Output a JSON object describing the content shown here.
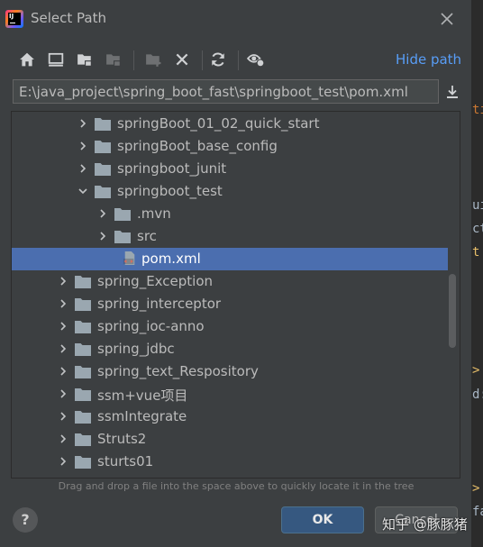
{
  "dialog": {
    "title": "Select Path",
    "logo_text": "IJ",
    "hide_path_label": "Hide path",
    "path_value": "E:\\java_project\\spring_boot_fast\\springboot_test\\pom.xml",
    "hint": "Drag and drop a file into the space above to quickly locate it in the tree",
    "help_label": "?",
    "ok_label": "OK",
    "cancel_label": "Cancel",
    "accent_color": "#4b6eaf"
  },
  "toolbar": {
    "icons": [
      "home-icon",
      "desktop-icon",
      "project-folder-icon",
      "module-folder-icon",
      "new-folder-icon",
      "delete-icon",
      "refresh-icon",
      "show-hidden-icon"
    ]
  },
  "tree": {
    "rows": [
      {
        "label": "springBoot_01_02_quick_start",
        "type": "folder",
        "expanded": false,
        "level": 3
      },
      {
        "label": "springBoot_base_config",
        "type": "folder",
        "expanded": false,
        "level": 3
      },
      {
        "label": "springboot_junit",
        "type": "folder",
        "expanded": false,
        "level": 3
      },
      {
        "label": "springboot_test",
        "type": "folder",
        "expanded": true,
        "level": 3
      },
      {
        "label": ".mvn",
        "type": "folder",
        "expanded": false,
        "level": 4
      },
      {
        "label": "src",
        "type": "folder",
        "expanded": false,
        "level": 4
      },
      {
        "label": "pom.xml",
        "type": "maven-file",
        "selected": true,
        "level": 4
      },
      {
        "label": "spring_Exception",
        "type": "folder",
        "expanded": false,
        "level": 2
      },
      {
        "label": "spring_interceptor",
        "type": "folder",
        "expanded": false,
        "level": 2
      },
      {
        "label": "spring_ioc-anno",
        "type": "folder",
        "expanded": false,
        "level": 2
      },
      {
        "label": "spring_jdbc",
        "type": "folder",
        "expanded": false,
        "level": 2
      },
      {
        "label": "spring_text_Respository",
        "type": "folder",
        "expanded": false,
        "level": 2
      },
      {
        "label": "ssm+vue项目",
        "type": "folder",
        "expanded": false,
        "level": 2
      },
      {
        "label": "ssmIntegrate",
        "type": "folder",
        "expanded": false,
        "level": 2
      },
      {
        "label": "Struts2",
        "type": "folder",
        "expanded": false,
        "level": 2
      },
      {
        "label": "sturts01",
        "type": "folder",
        "expanded": false,
        "level": 2
      }
    ]
  },
  "background_editor": {
    "fragments": [
      "ti",
      "ui",
      "ct",
      "t",
      ">",
      "d:",
      ">",
      "fa"
    ]
  },
  "watermark": "知乎 @豚豚猪"
}
